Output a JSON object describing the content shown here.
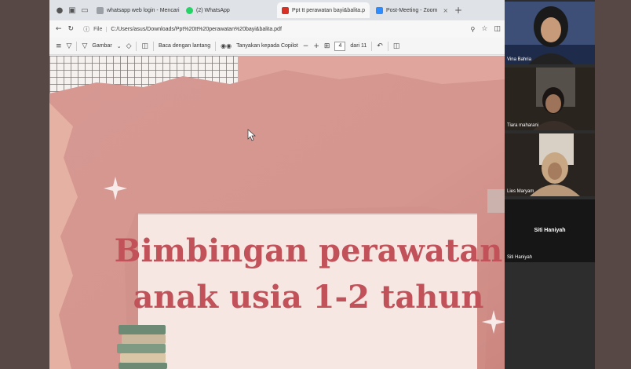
{
  "browser": {
    "tabs": [
      {
        "label": "whatsapp web login - Mencari",
        "favicon_color": "#9aa0a6",
        "active": false
      },
      {
        "label": "(2) WhatsApp",
        "favicon_color": "#25d366",
        "active": false
      },
      {
        "label": "Ppt tt perawatan bayi&balita.p",
        "favicon_color": "#d93025",
        "active": true
      },
      {
        "label": "Post-Meeting - Zoom",
        "favicon_color": "#2d8cff",
        "active": false
      }
    ],
    "address": {
      "scheme_label": "File",
      "url": "C:/Users/asus/Downloads/Ppt%20tt%20perawatan%20bayi&balita.pdf"
    },
    "pdf_toolbar": {
      "draw_label": "Gambar",
      "read_aloud_label": "Baca dengan lantang",
      "ask_copilot_label": "Tanyakan kepada Copilot",
      "page_current": "4",
      "page_total_label": "dari 11"
    }
  },
  "slide": {
    "title_line1": "Bimbingan perawatan",
    "title_line2": "anak usia 1-2 tahun"
  },
  "zoom": {
    "participants": [
      {
        "name": "Vina Bahria",
        "has_video": true
      },
      {
        "name": "Tiara maharani",
        "has_video": true
      },
      {
        "name": "Lies Maryam",
        "has_video": true
      },
      {
        "name": "Siti Haniyah",
        "has_video": false,
        "center_name": "Siti Haniyah"
      }
    ]
  },
  "colors": {
    "slide_pink": "#d89a94",
    "slide_title": "#c2525a",
    "slide_paper": "#f6e7e3"
  }
}
